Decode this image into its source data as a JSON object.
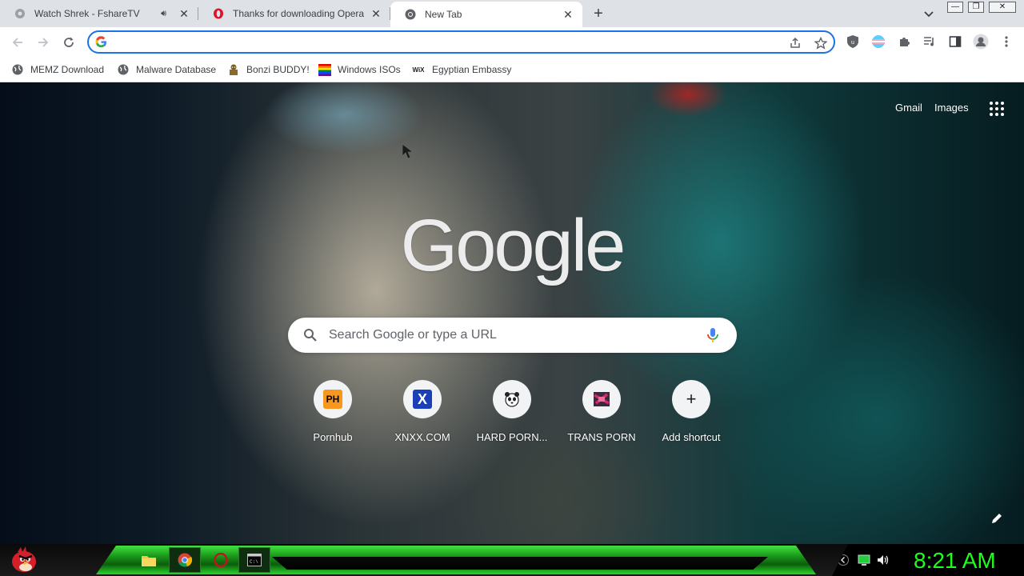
{
  "tabs": [
    {
      "title": "Watch Shrek - FshareTV",
      "has_audio": true,
      "favicon": "fsharetv-icon"
    },
    {
      "title": "Thanks for downloading Opera",
      "favicon": "opera-icon"
    },
    {
      "title": "New Tab",
      "favicon": "chrome-icon",
      "active": true
    }
  ],
  "window_controls": {
    "minimize": "—",
    "restore": "❐",
    "close": "✕"
  },
  "omnibox": {
    "value": "",
    "placeholder": ""
  },
  "bookmarks": [
    {
      "label": "MEMZ Download",
      "icon": "globe-icon"
    },
    {
      "label": "Malware Database",
      "icon": "globe-icon"
    },
    {
      "label": "Bonzi BUDDY!",
      "icon": "bonzi-icon"
    },
    {
      "label": "Windows ISOs",
      "icon": "windows-flag-icon"
    },
    {
      "label": "Egyptian Embassy",
      "icon": "wix-icon"
    }
  ],
  "ntp": {
    "gmail": "Gmail",
    "images": "Images",
    "logo": "Google",
    "search_placeholder": "Search Google or type a URL",
    "shortcuts": [
      {
        "label": "Pornhub",
        "icon_text": "PH"
      },
      {
        "label": "XNXX.COM",
        "icon_text": "X"
      },
      {
        "label": "HARD PORN...",
        "icon_text": ""
      },
      {
        "label": "TRANS PORN",
        "icon_text": ""
      },
      {
        "label": "Add shortcut",
        "icon_text": "+"
      }
    ]
  },
  "taskbar": {
    "clock": "8:21 AM"
  },
  "colors": {
    "accent_blue": "#1a73e8",
    "clock_green": "#1bff1b",
    "taskbar_green": "#2bd52b"
  }
}
